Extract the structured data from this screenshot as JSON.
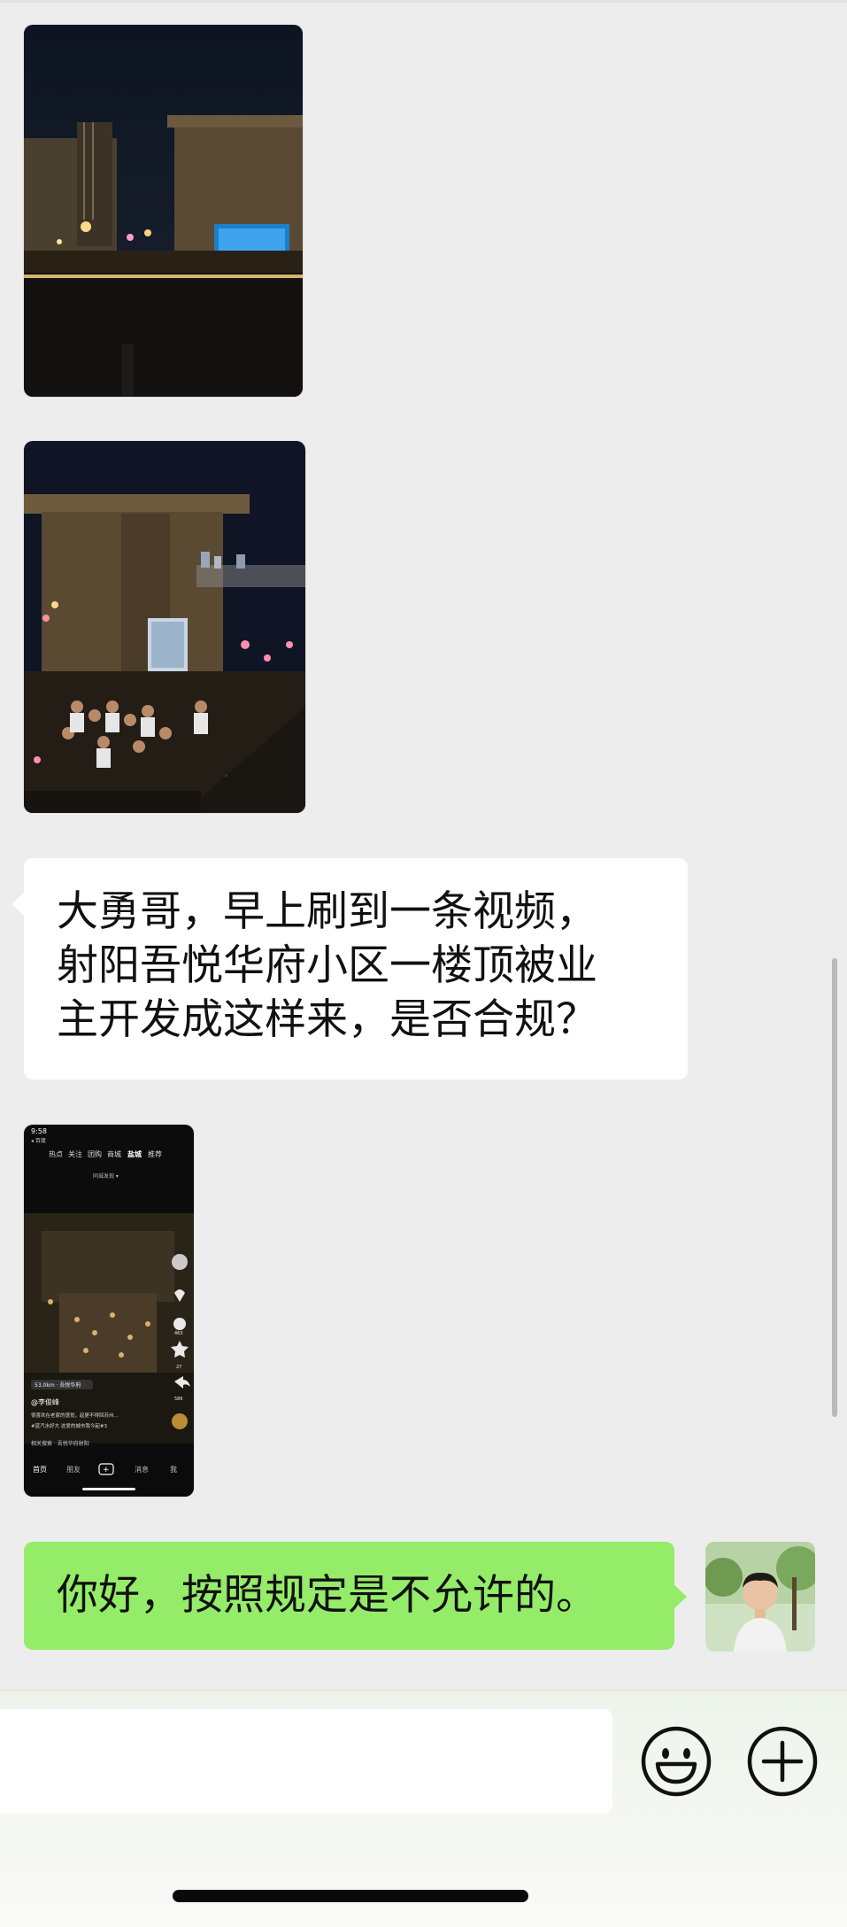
{
  "messages": [
    {
      "type": "image",
      "side": "incoming",
      "desc": "rooftop-night-photo"
    },
    {
      "type": "image",
      "side": "incoming",
      "desc": "rooftop-party-photo"
    },
    {
      "type": "text",
      "side": "incoming",
      "lines": [
        "大勇哥，早上刷到一条视频，",
        "射阳吾悦华府小区一楼顶被业",
        "主开发成这样来，是否合规？"
      ]
    },
    {
      "type": "image",
      "side": "incoming",
      "desc": "douyin-video-screenshot"
    },
    {
      "type": "text",
      "side": "outgoing",
      "lines": [
        "你好，按照规定是不允许的。"
      ]
    }
  ],
  "video_screenshot": {
    "time": "9:58",
    "back_label": "◂ 百度",
    "tabs": [
      "热点",
      "关注",
      "团购",
      "商城",
      "盐城",
      "推荐"
    ],
    "active_tab": "盐城",
    "subtitle": "同城发现 ▾",
    "location": "53.0km · 吾悦华府",
    "author": "@李俊峰",
    "caption": "很喜欢在老家的感觉，起更不得回苏州...",
    "tag_line": "#蓝汽水好大  这爱的城市我今起#3",
    "related": "相关搜索 · 吾悦华府射阳",
    "counts": {
      "comments": "463",
      "stars": "27",
      "shares": "586"
    },
    "bottom_nav": [
      "首页",
      "朋友",
      "+",
      "消息",
      "我"
    ]
  },
  "input_bar": {
    "placeholder": "",
    "emoji_icon": "emoji-icon",
    "plus_icon": "plus-circle-icon"
  },
  "colors": {
    "background": "#ededed",
    "incoming_bubble": "#ffffff",
    "outgoing_bubble": "#95ec69"
  }
}
